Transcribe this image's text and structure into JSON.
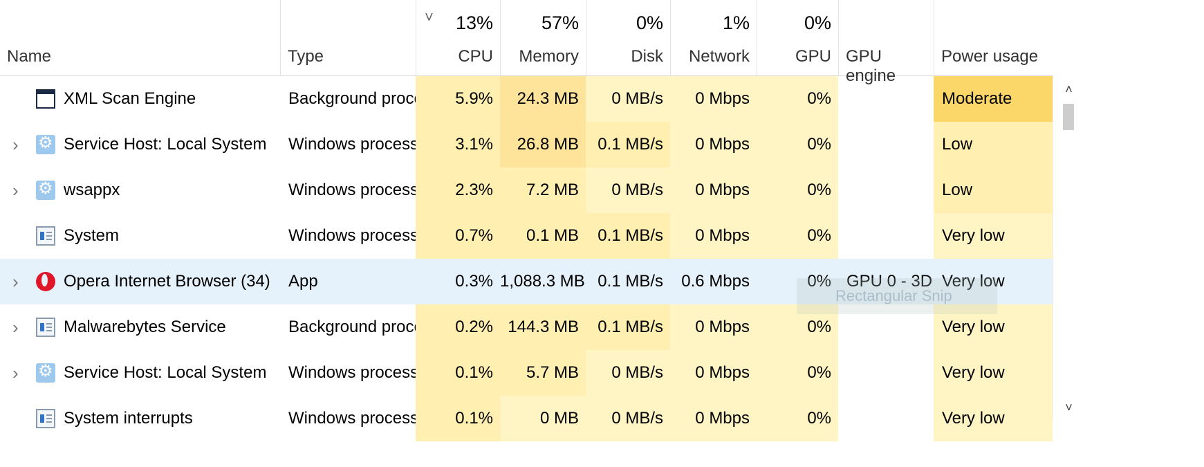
{
  "header": {
    "name_label": "Name",
    "type_label": "Type",
    "cpu_pct": "13%",
    "cpu_label": "CPU",
    "memory_pct": "57%",
    "memory_label": "Memory",
    "disk_pct": "0%",
    "disk_label": "Disk",
    "network_pct": "1%",
    "network_label": "Network",
    "gpu_pct": "0%",
    "gpu_label": "GPU",
    "gpu_engine_label": "GPU engine",
    "power_label": "Power usage",
    "sort_indicator": "˅"
  },
  "processes": [
    {
      "name": "XML Scan Engine",
      "type": "Background process",
      "cpu": "5.9%",
      "memory": "24.3 MB",
      "disk": "0 MB/s",
      "network": "0 Mbps",
      "gpu": "0%",
      "gpu_engine": "",
      "power": "Moderate",
      "expander": "",
      "icon": "app-window-icon"
    },
    {
      "name": "Service Host: Local System",
      "type": "Windows process",
      "cpu": "3.1%",
      "memory": "26.8 MB",
      "disk": "0.1 MB/s",
      "network": "0 Mbps",
      "gpu": "0%",
      "gpu_engine": "",
      "power": "Low",
      "expander": "›",
      "icon": "gear-icon"
    },
    {
      "name": "wsappx",
      "type": "Windows process",
      "cpu": "2.3%",
      "memory": "7.2 MB",
      "disk": "0 MB/s",
      "network": "0 Mbps",
      "gpu": "0%",
      "gpu_engine": "",
      "power": "Low",
      "expander": "›",
      "icon": "gear-icon"
    },
    {
      "name": "System",
      "type": "Windows process",
      "cpu": "0.7%",
      "memory": "0.1 MB",
      "disk": "0.1 MB/s",
      "network": "0 Mbps",
      "gpu": "0%",
      "gpu_engine": "",
      "power": "Very low",
      "expander": "",
      "icon": "system-icon"
    },
    {
      "name": "Opera Internet Browser (34)",
      "type": "App",
      "cpu": "0.3%",
      "memory": "1,088.3 MB",
      "disk": "0.1 MB/s",
      "network": "0.6 Mbps",
      "gpu": "0%",
      "gpu_engine": "GPU 0 - 3D",
      "power": "Very low",
      "expander": "›",
      "icon": "opera-icon"
    },
    {
      "name": "Malwarebytes Service",
      "type": "Background process",
      "cpu": "0.2%",
      "memory": "144.3 MB",
      "disk": "0.1 MB/s",
      "network": "0 Mbps",
      "gpu": "0%",
      "gpu_engine": "",
      "power": "Very low",
      "expander": "›",
      "icon": "system-icon"
    },
    {
      "name": "Service Host: Local System",
      "type": "Windows process",
      "cpu": "0.1%",
      "memory": "5.7 MB",
      "disk": "0 MB/s",
      "network": "0 Mbps",
      "gpu": "0%",
      "gpu_engine": "",
      "power": "Very low",
      "expander": "›",
      "icon": "gear-icon"
    },
    {
      "name": "System interrupts",
      "type": "Windows process",
      "cpu": "0.1%",
      "memory": "0 MB",
      "disk": "0 MB/s",
      "network": "0 Mbps",
      "gpu": "0%",
      "gpu_engine": "",
      "power": "Very low",
      "expander": "",
      "icon": "system-icon"
    }
  ],
  "overlay": {
    "ghost_label": "Rectangular Snip"
  },
  "scrollbar": {
    "up_arrow": "˄",
    "down_arrow": "˅"
  }
}
